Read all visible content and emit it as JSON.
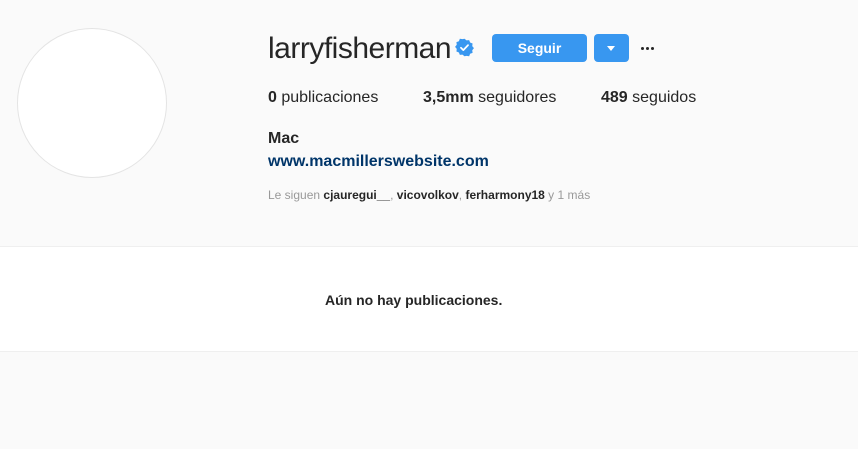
{
  "profile": {
    "username": "larryfisherman",
    "verified_icon": "verified-badge-icon",
    "follow_label": "Seguir",
    "more_icon": "more-options-icon",
    "full_name": "Mac",
    "website": "www.macmillerswebsite.com"
  },
  "stats": {
    "posts_value": "0",
    "posts_label": "publicaciones",
    "followers_value": "3,5mm",
    "followers_label": "seguidores",
    "following_value": "489",
    "following_label": "seguidos"
  },
  "followed_by": {
    "prefix": "Le siguen",
    "accounts": [
      "cjauregui__",
      "vicovolkov",
      "ferharmony18"
    ],
    "sep1": ", ",
    "sep2": ", ",
    "suffix": " y 1 más"
  },
  "content": {
    "empty_message": "Aún no hay publicaciones."
  },
  "colors": {
    "accent": "#3897f0",
    "link": "#003569",
    "background": "#fafafa"
  }
}
